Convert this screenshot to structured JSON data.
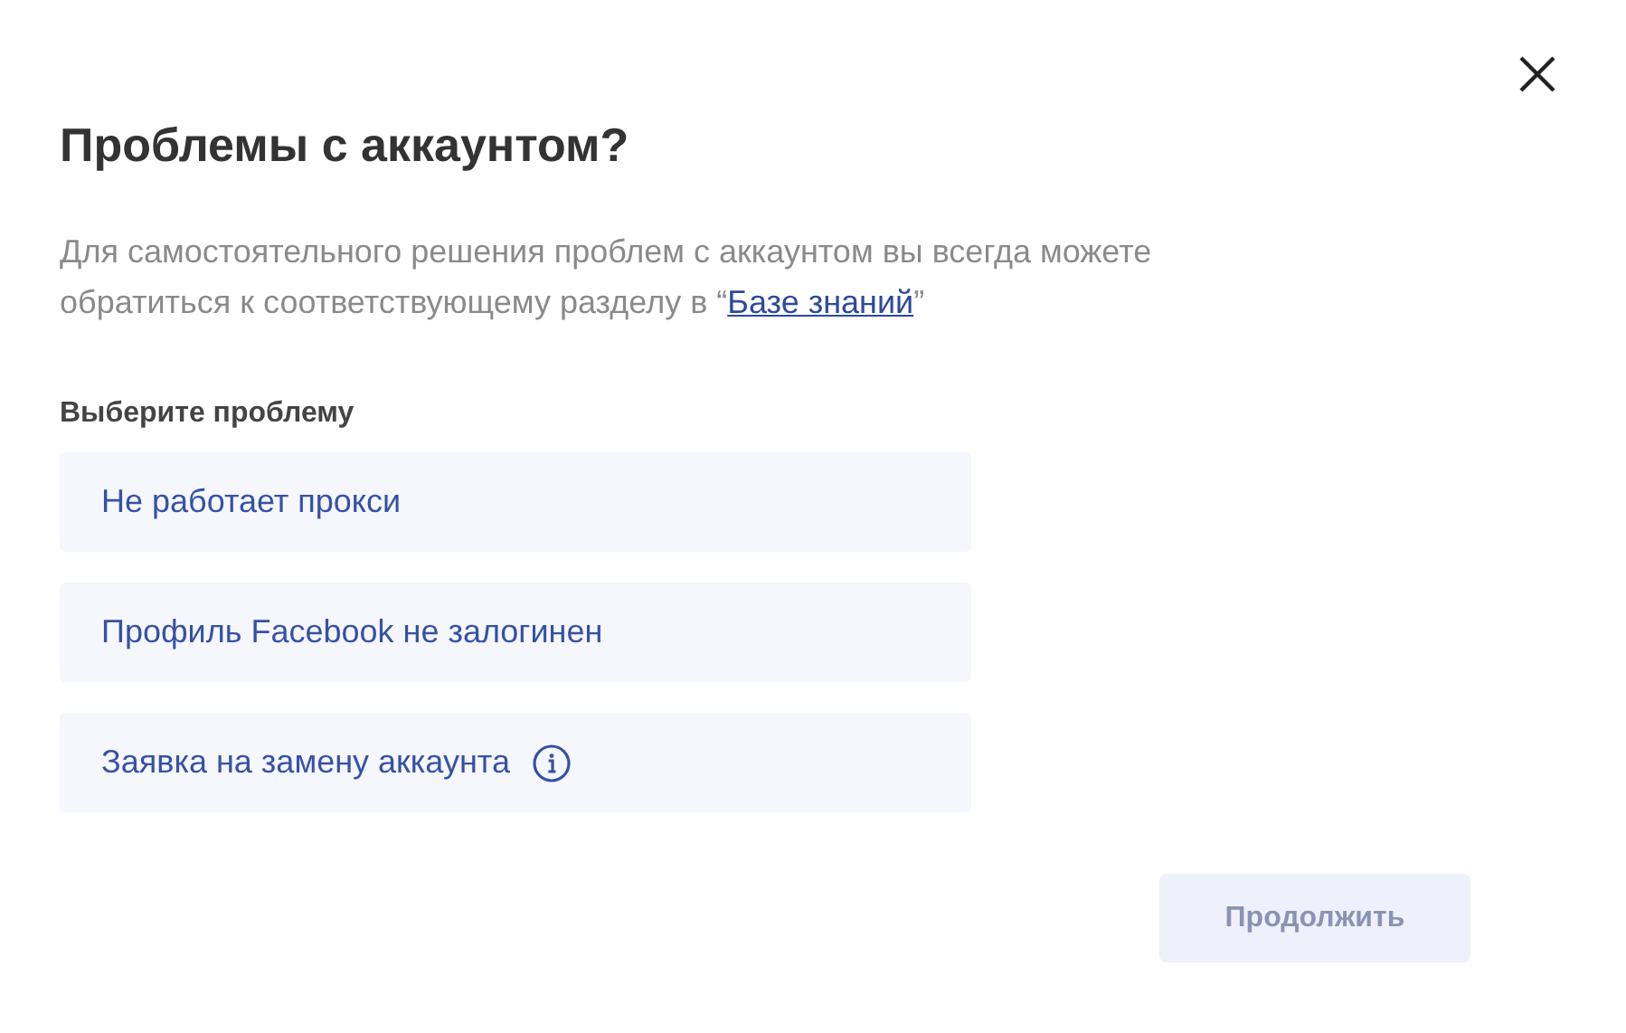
{
  "dialog": {
    "title": "Проблемы с аккаунтом?",
    "description": {
      "text_before": "Для самостоятельного решения проблем с аккаунтом вы всегда можете обратиться к соответствующему разделу в “",
      "link": "Базе знаний",
      "text_after": "”"
    },
    "options_label": "Выберите проблему",
    "options": [
      {
        "label": "Не работает прокси",
        "kind": "plain",
        "selected": false
      },
      {
        "label": "Профиль Facebook не залогинен",
        "kind": "plain",
        "selected": false
      },
      {
        "label": "Заявка на замену аккаунта",
        "kind": "info",
        "selected": false
      }
    ],
    "continue_button": {
      "label": "Продолжить",
      "disabled": true
    }
  }
}
